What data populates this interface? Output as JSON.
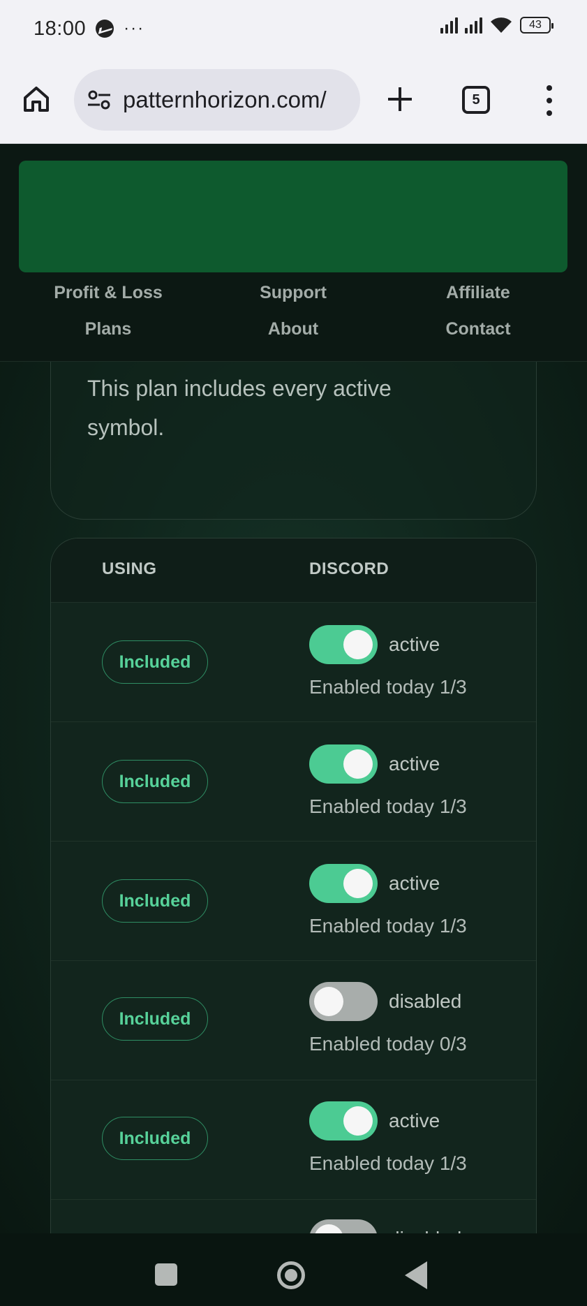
{
  "status_bar": {
    "time": "18:00",
    "more": "···",
    "battery": "43",
    "icons": [
      "messenger-icon",
      "signal-icon",
      "signal-icon",
      "wifi-icon",
      "battery-icon"
    ]
  },
  "browser": {
    "url": "patternhorizon.com/",
    "tab_count": "5",
    "icons": [
      "home-icon",
      "site-settings-icon",
      "plus-icon",
      "tabs-icon",
      "more-vert-icon"
    ]
  },
  "site_nav": {
    "banner_color": "#0e5a2e",
    "links": [
      "Profit & Loss",
      "Support",
      "Affiliate",
      "Plans",
      "About",
      "Contact"
    ]
  },
  "plan_card": {
    "text": "This plan includes every active symbol."
  },
  "table": {
    "headers": [
      "USING",
      "DISCORD"
    ],
    "rows": [
      {
        "using": "Included",
        "toggle": "on",
        "status": "active",
        "enabled": "Enabled today 1/3"
      },
      {
        "using": "Included",
        "toggle": "on",
        "status": "active",
        "enabled": "Enabled today 1/3"
      },
      {
        "using": "Included",
        "toggle": "on",
        "status": "active",
        "enabled": "Enabled today 1/3"
      },
      {
        "using": "Included",
        "toggle": "off",
        "status": "disabled",
        "enabled": "Enabled today 0/3"
      },
      {
        "using": "Included",
        "toggle": "on",
        "status": "active",
        "enabled": "Enabled today 1/3"
      },
      {
        "using": "",
        "toggle": "off",
        "status": "disabled",
        "enabled": ""
      }
    ],
    "colors": {
      "accent": "#4ccb93",
      "badge_text": "#57d29a",
      "toggle_off": "#a8adab"
    }
  },
  "android_nav": {
    "icons": [
      "recents-icon",
      "home-circle-icon",
      "back-icon"
    ]
  }
}
